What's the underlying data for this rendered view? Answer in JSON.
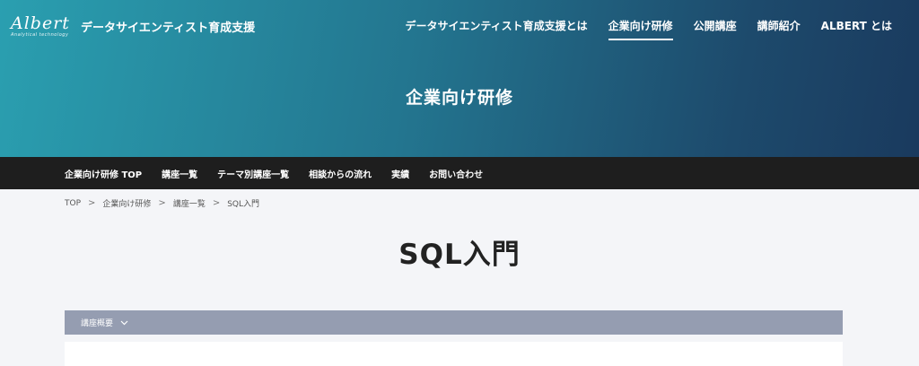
{
  "header": {
    "logo_text": "Albert",
    "logo_tagline": "Analytical technology",
    "site_title": "データサイエンティスト育成支援"
  },
  "top_nav": {
    "items": [
      {
        "label": "データサイエンティスト育成支援とは",
        "active": false
      },
      {
        "label": "企業向け研修",
        "active": true
      },
      {
        "label": "公開講座",
        "active": false
      },
      {
        "label": "講師紹介",
        "active": false
      },
      {
        "label": "ALBERT とは",
        "active": false
      }
    ]
  },
  "hero": {
    "title": "企業向け研修"
  },
  "sub_nav": {
    "items": [
      {
        "label": "企業向け研修 TOP"
      },
      {
        "label": "講座一覧"
      },
      {
        "label": "テーマ別講座一覧"
      },
      {
        "label": "相談からの流れ"
      },
      {
        "label": "実績"
      },
      {
        "label": "お問い合わせ"
      }
    ]
  },
  "breadcrumb": {
    "items": [
      {
        "label": "TOP"
      },
      {
        "label": "企業向け研修"
      },
      {
        "label": "講座一覧"
      },
      {
        "label": "SQL入門"
      }
    ],
    "separator": ">"
  },
  "page": {
    "title": "SQL入門"
  },
  "accordion": {
    "label": "講座概要",
    "icon": "chevron-down-icon"
  },
  "colors": {
    "hero_gradient_start": "#2a9fb0",
    "hero_gradient_end": "#1a3a5e",
    "subnav_bg": "#1e1e1e",
    "accordion_bg": "#959db1",
    "page_bg": "#f4f5f8"
  }
}
